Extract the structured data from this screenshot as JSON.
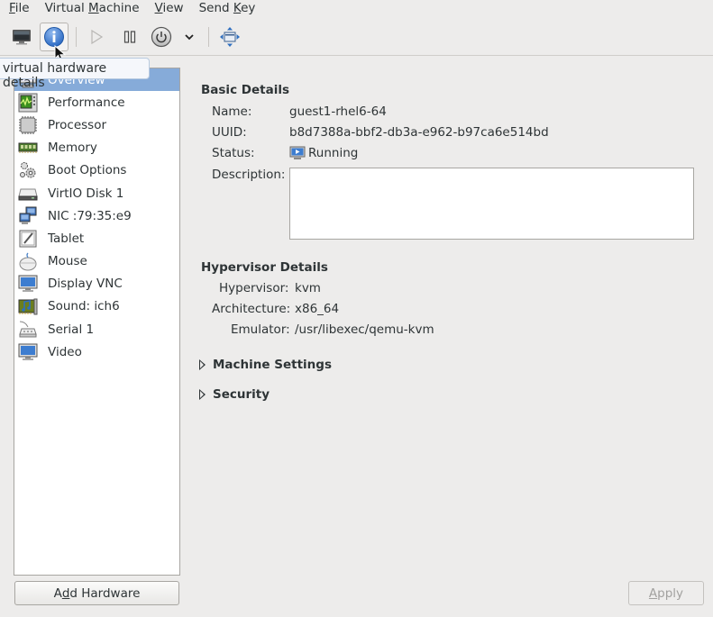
{
  "menubar": {
    "items": [
      {
        "label": "File",
        "mnemonic": "F"
      },
      {
        "label": "Virtual Machine",
        "mnemonic": "M"
      },
      {
        "label": "View",
        "mnemonic": "V"
      },
      {
        "label": "Send Key",
        "mnemonic": "K"
      }
    ]
  },
  "toolbar": {
    "buttons": [
      {
        "name": "console",
        "icon": "monitor-icon"
      },
      {
        "name": "details",
        "icon": "info-icon",
        "active": true
      },
      {
        "name": "run",
        "icon": "play-icon",
        "disabled": true
      },
      {
        "name": "pause",
        "icon": "pause-icon"
      },
      {
        "name": "shutdown",
        "icon": "power-icon"
      },
      {
        "name": "shutdown-menu",
        "icon": "chevron-down-icon"
      },
      {
        "name": "fullscreen",
        "icon": "fullscreen-icon"
      }
    ]
  },
  "tooltip": {
    "text": "virtual hardware details"
  },
  "sidebar": {
    "selected": "Overview",
    "items": [
      {
        "label": "Overview",
        "icon": "overview-icon"
      },
      {
        "label": "Performance",
        "icon": "performance-icon"
      },
      {
        "label": "Processor",
        "icon": "processor-icon"
      },
      {
        "label": "Memory",
        "icon": "memory-icon"
      },
      {
        "label": "Boot Options",
        "icon": "gears-icon"
      },
      {
        "label": "VirtIO Disk 1",
        "icon": "disk-icon"
      },
      {
        "label": "NIC :79:35:e9",
        "icon": "network-icon"
      },
      {
        "label": "Tablet",
        "icon": "tablet-icon"
      },
      {
        "label": "Mouse",
        "icon": "mouse-icon"
      },
      {
        "label": "Display VNC",
        "icon": "display-icon"
      },
      {
        "label": "Sound: ich6",
        "icon": "sound-icon"
      },
      {
        "label": "Serial 1",
        "icon": "serial-icon"
      },
      {
        "label": "Video",
        "icon": "video-icon"
      }
    ]
  },
  "basic_details": {
    "title": "Basic Details",
    "name_label": "Name:",
    "name_value": "guest1-rhel6-64",
    "uuid_label": "UUID:",
    "uuid_value": "b8d7388a-bbf2-db3a-e962-b97ca6e514bd",
    "status_label": "Status:",
    "status_value": "Running",
    "description_label": "Description:",
    "description_value": ""
  },
  "hypervisor_details": {
    "title": "Hypervisor Details",
    "hypervisor_label": "Hypervisor:",
    "hypervisor_value": "kvm",
    "architecture_label": "Architecture:",
    "architecture_value": "x86_64",
    "emulator_label": "Emulator:",
    "emulator_value": "/usr/libexec/qemu-kvm"
  },
  "expanders": {
    "machine_settings": "Machine Settings",
    "security": "Security"
  },
  "buttons": {
    "add_hardware": {
      "prefix": "A",
      "mnemonic": "d",
      "suffix": "d Hardware"
    },
    "apply": {
      "prefix": "",
      "mnemonic": "A",
      "suffix": "pply"
    }
  }
}
